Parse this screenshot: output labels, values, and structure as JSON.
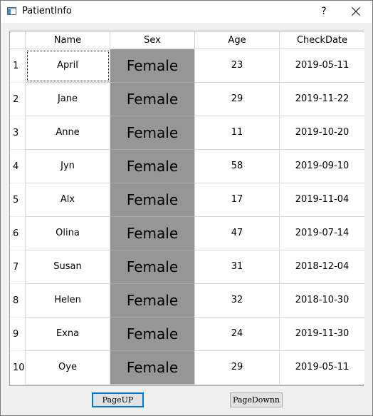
{
  "window": {
    "title": "PatientInfo",
    "help_label": "?"
  },
  "table": {
    "columns": [
      "Name",
      "Sex",
      "Age",
      "CheckDate"
    ],
    "row_numbers": [
      "1",
      "2",
      "3",
      "4",
      "5",
      "6",
      "7",
      "8",
      "9",
      "10"
    ],
    "rows": [
      {
        "name": "April",
        "sex": "Female",
        "age": "23",
        "date": "2019-05-11"
      },
      {
        "name": "Jane",
        "sex": "Female",
        "age": "29",
        "date": "2019-11-22"
      },
      {
        "name": "Anne",
        "sex": "Female",
        "age": "11",
        "date": "2019-10-20"
      },
      {
        "name": "Jyn",
        "sex": "Female",
        "age": "58",
        "date": "2019-09-10"
      },
      {
        "name": "Alx",
        "sex": "Female",
        "age": "17",
        "date": "2019-11-04"
      },
      {
        "name": "Olina",
        "sex": "Female",
        "age": "47",
        "date": "2019-07-14"
      },
      {
        "name": "Susan",
        "sex": "Female",
        "age": "31",
        "date": "2018-12-04"
      },
      {
        "name": "Helen",
        "sex": "Female",
        "age": "32",
        "date": "2018-10-30"
      },
      {
        "name": "Exna",
        "sex": "Female",
        "age": "24",
        "date": "2019-11-30"
      },
      {
        "name": "Oye",
        "sex": "Female",
        "age": "29",
        "date": "2019-05-11"
      }
    ],
    "sex_cell_color": "#969696"
  },
  "buttons": {
    "page_up": "PageUP",
    "page_down": "PageDownn"
  },
  "colors": {
    "accent": "#0078d7",
    "window_bg": "#f0f0f0"
  }
}
